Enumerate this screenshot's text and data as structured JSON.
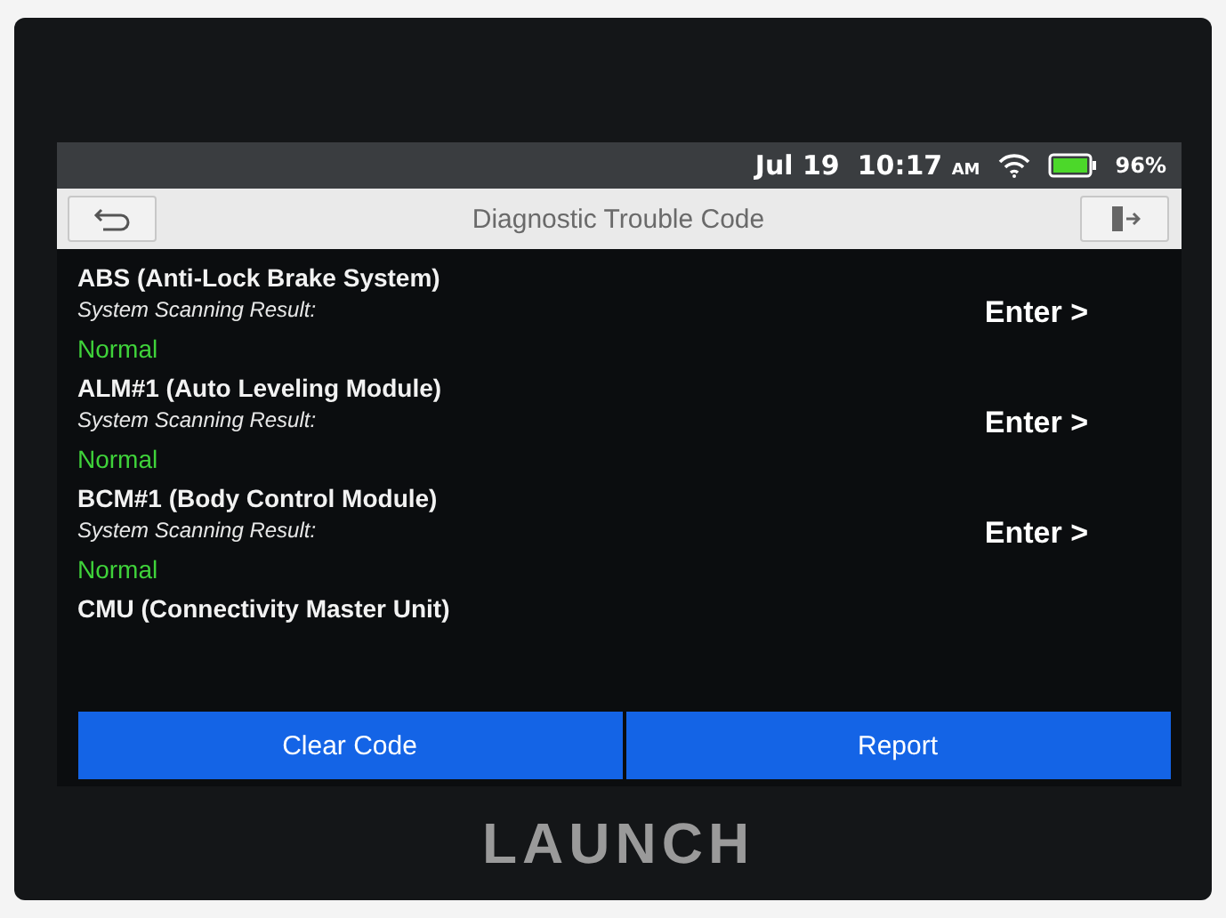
{
  "status_bar": {
    "date": "Jul 19",
    "time": "10:17",
    "meridiem": "AM",
    "battery": "96%"
  },
  "title_bar": {
    "title": "Diagnostic Trouble Code"
  },
  "systems": [
    {
      "name": "ABS (Anti-Lock Brake System)",
      "result_label": "System Scanning Result:",
      "result": "Normal",
      "action": "Enter >"
    },
    {
      "name": "ALM#1 (Auto Leveling Module)",
      "result_label": "System Scanning Result:",
      "result": "Normal",
      "action": "Enter >"
    },
    {
      "name": "BCM#1 (Body Control Module)",
      "result_label": "System Scanning Result:",
      "result": "Normal",
      "action": "Enter >"
    },
    {
      "name": "CMU (Connectivity Master Unit)"
    }
  ],
  "buttons": [
    "Clear Code",
    "Report"
  ],
  "device": {
    "brand": "LAUNCH"
  }
}
